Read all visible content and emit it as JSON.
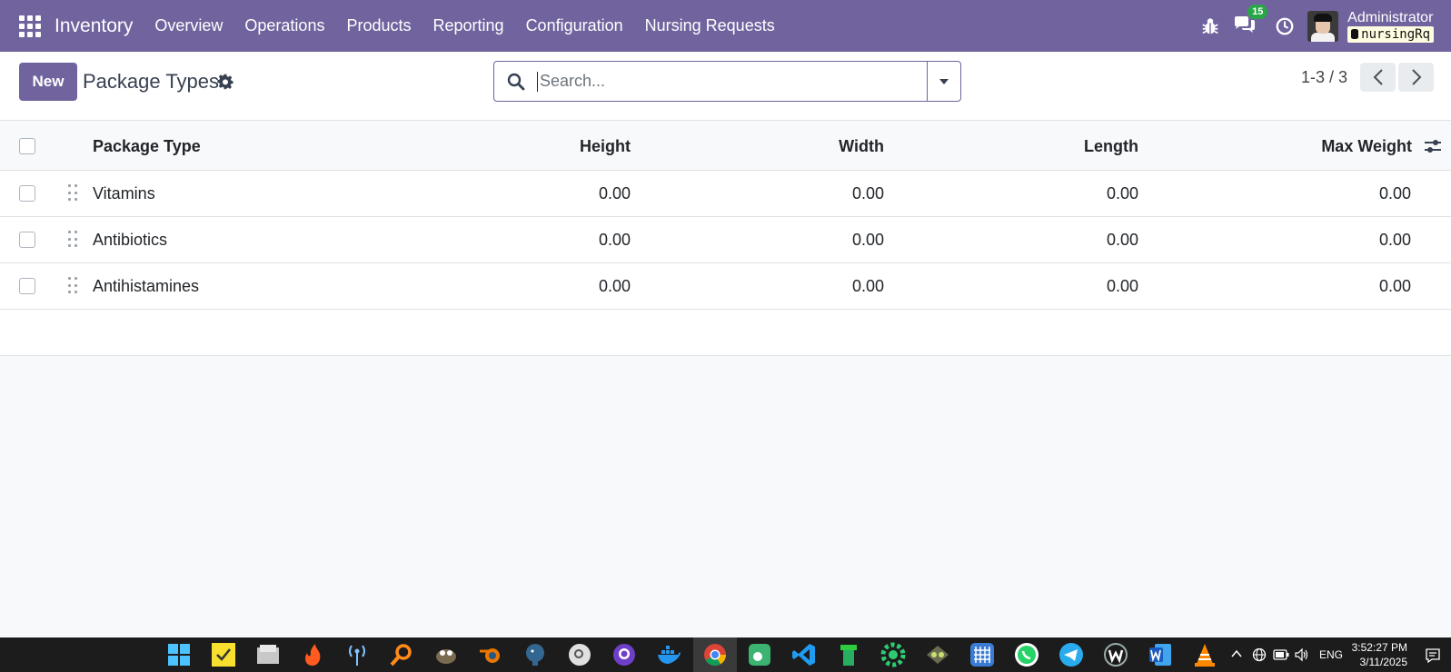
{
  "navbar": {
    "app_name": "Inventory",
    "menu": [
      "Overview",
      "Operations",
      "Products",
      "Reporting",
      "Configuration",
      "Nursing Requests"
    ],
    "messages_badge": "15",
    "user_name": "Administrator",
    "database": "nursingRq",
    "accent_color": "#71639e"
  },
  "control_panel": {
    "new_label": "New",
    "title": "Package Types",
    "search_placeholder": "Search...",
    "pager": "1-3 / 3"
  },
  "table": {
    "headers": {
      "name": "Package Type",
      "height": "Height",
      "width": "Width",
      "length": "Length",
      "max_weight": "Max Weight"
    },
    "rows": [
      {
        "name": "Vitamins",
        "height": "0.00",
        "width": "0.00",
        "length": "0.00",
        "max_weight": "0.00"
      },
      {
        "name": "Antibiotics",
        "height": "0.00",
        "width": "0.00",
        "length": "0.00",
        "max_weight": "0.00"
      },
      {
        "name": "Antihistamines",
        "height": "0.00",
        "width": "0.00",
        "length": "0.00",
        "max_weight": "0.00"
      }
    ]
  },
  "taskbar": {
    "icons": [
      "windows-start-icon",
      "sticky-notes-icon",
      "file-explorer-icon",
      "firefox-icon",
      "network-icon",
      "search-tool-icon",
      "gimp-icon",
      "blender-icon",
      "postgresql-icon",
      "search-circle-icon",
      "github-icon",
      "docker-icon",
      "chrome-icon",
      "screen-capture-icon",
      "vscode-icon",
      "pipe-icon",
      "settings-gear-icon",
      "twinkle-icon",
      "grid-app-icon",
      "whatsapp-icon",
      "telegram-icon",
      "wps-icon",
      "word-icon",
      "vlc-icon"
    ],
    "language": "ENG",
    "time": "3:52:27 PM",
    "date": "3/11/2025"
  }
}
